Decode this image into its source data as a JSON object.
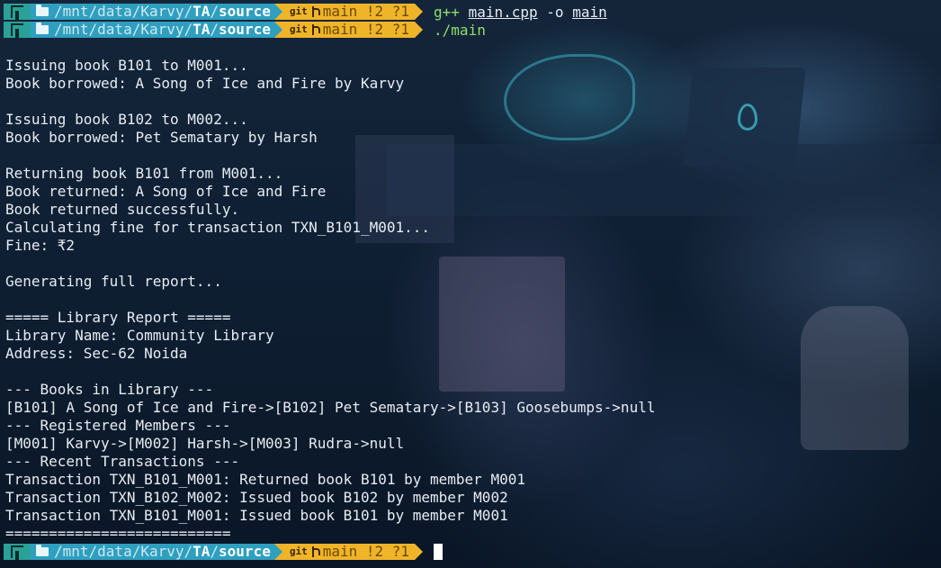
{
  "prompt": {
    "path_prefix": "/mnt/data/Karvy/",
    "path_mid": "TA",
    "path_sep": "/",
    "path_last": "source",
    "git_label": "git",
    "branch": "main !2 ?1"
  },
  "commands": {
    "first_bin": "g++",
    "first_src": "main.cpp",
    "first_flag": "-o",
    "first_out": "main",
    "second": "./main"
  },
  "output": [
    "Issuing book B101 to M001...",
    "Book borrowed: A Song of Ice and Fire by Karvy",
    "",
    "Issuing book B102 to M002...",
    "Book borrowed: Pet Sematary by Harsh",
    "",
    "Returning book B101 from M001...",
    "Book returned: A Song of Ice and Fire",
    "Book returned successfully.",
    "Calculating fine for transaction TXN_B101_M001...",
    "Fine: ₹2",
    "",
    "Generating full report...",
    "",
    "===== Library Report =====",
    "Library Name: Community Library",
    "Address: Sec-62 Noida",
    "",
    "--- Books in Library ---",
    "[B101] A Song of Ice and Fire->[B102] Pet Sematary->[B103] Goosebumps->null",
    "--- Registered Members ---",
    "[M001] Karvy->[M002] Harsh->[M003] Rudra->null",
    "--- Recent Transactions ---",
    "Transaction TXN_B101_M001: Returned book B101 by member M001",
    "Transaction TXN_B102_M002: Issued book B102 by member M002",
    "Transaction TXN_B101_M001: Issued book B101 by member M001",
    "=========================="
  ],
  "colors": {
    "os_segment": "#2aa198",
    "path_segment": "#2e9fbf",
    "git_segment": "#f0b429",
    "command": "#8ee06a",
    "text": "#e6ecf2"
  }
}
